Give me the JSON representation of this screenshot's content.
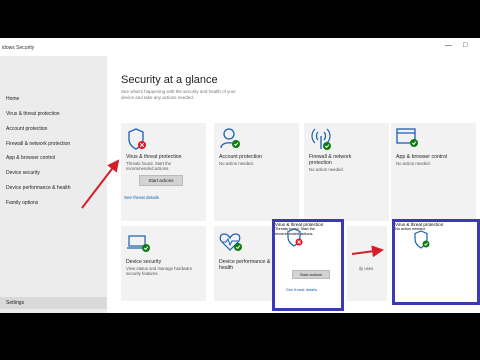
{
  "window": {
    "title": "idows Security",
    "controls": {
      "minimize": "—",
      "maximize": "□"
    }
  },
  "sidebar": {
    "items": [
      "Home",
      "Virus & threat protection",
      "Account protection",
      "Firewall & network protection",
      "App & browser control",
      "Device security",
      "Device performance & health",
      "Family options"
    ],
    "settings": "Settings"
  },
  "main": {
    "heading": "Security at a glance",
    "subtitle": "See what's happening with the security and health of your device and take any actions needed.",
    "tiles": {
      "virus": {
        "title": "Virus & threat protection",
        "desc": "Threats found. Start the recommended actions.",
        "button": "Start actions",
        "link": "See threat details",
        "icon": "shield-error-icon"
      },
      "account": {
        "title": "Account protection",
        "desc": "No action needed.",
        "icon": "person-check-icon"
      },
      "firewall": {
        "title": "Firewall & network protection",
        "desc": "No action needed.",
        "icon": "wifi-antenna-icon"
      },
      "app": {
        "title": "App & browser control",
        "desc": "No action needed.",
        "icon": "browser-window-icon"
      },
      "device_security": {
        "title": "Device security",
        "desc": "View status and manage hardware security features.",
        "icon": "laptop-check-icon"
      },
      "performance": {
        "title": "Device performance & health",
        "icon": "heart-pulse-icon"
      },
      "family": {
        "partial_desc": "ily uses"
      }
    }
  },
  "annotations": {
    "before": {
      "title": "Virus & threat protection",
      "desc": "Threats found. Start the recommended actions.",
      "button": "Start actions",
      "link": "See threat details"
    },
    "after": {
      "title": "Virus & threat protection",
      "desc": "No action needed."
    }
  },
  "colors": {
    "accent": "#1a5fb4",
    "ok": "#107c10",
    "error": "#e81123",
    "annotation_border": "#3a3ab4",
    "arrow": "#d21f2b"
  }
}
